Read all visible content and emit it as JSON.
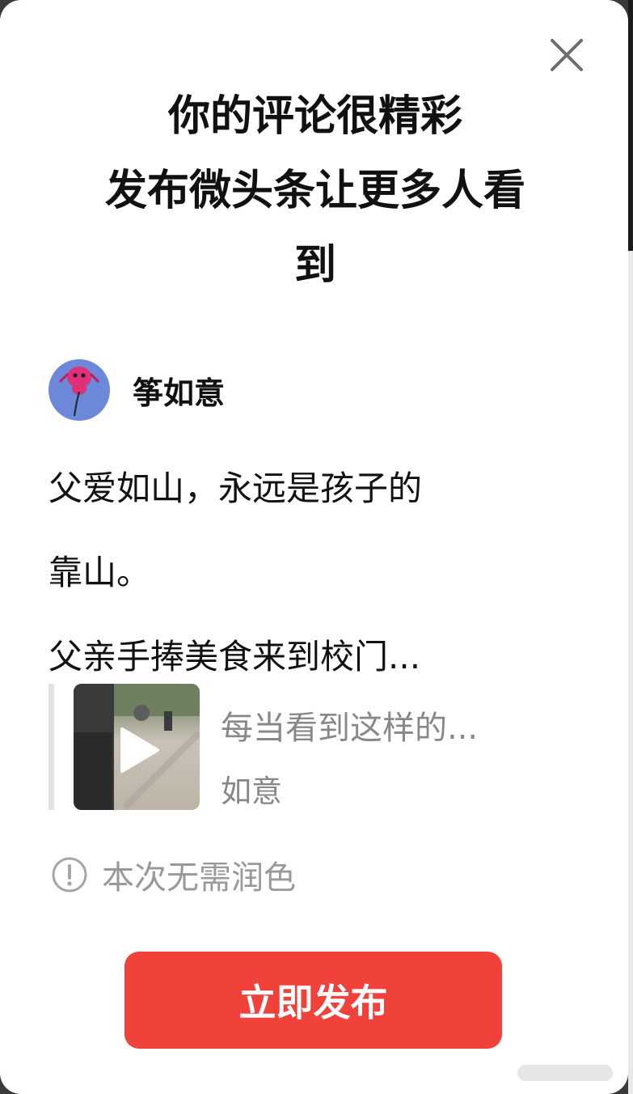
{
  "dialog": {
    "title_lines": [
      "你的评论很精彩",
      "发布微头条让更多人看",
      "到"
    ],
    "close_icon": "close-icon"
  },
  "author": {
    "name": "筝如意",
    "avatar_icon": "kite-avatar"
  },
  "comment": {
    "lines": [
      "父爱如山，永远是孩子的",
      "靠山。",
      "父亲手捧美食来到校门..."
    ]
  },
  "quoted_post": {
    "text": "每当看到这样的...",
    "author": "如意",
    "thumbnail_icon": "play-icon"
  },
  "notice": {
    "text": "本次无需润色",
    "icon": "info-icon"
  },
  "publish_button": {
    "label": "立即发布"
  },
  "colors": {
    "accent": "#f0423a",
    "muted_text": "#888888"
  }
}
